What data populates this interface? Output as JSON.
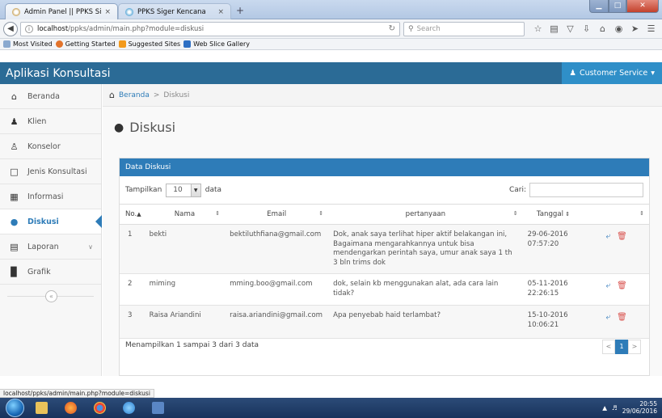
{
  "browser": {
    "tabs": [
      {
        "title": "Admin Panel || PPKS Siger ...",
        "close": "×"
      },
      {
        "title": "PPKS Siger Kencana",
        "close": "×"
      }
    ],
    "new_tab": "+",
    "url_host": "localhost",
    "url_path": "/ppks/admin/main.php?module=diskusi",
    "search_placeholder": "Search",
    "bookmarks": [
      "Most Visited",
      "Getting Started",
      "Suggested Sites",
      "Web Slice Gallery"
    ],
    "status_url": "localhost/ppks/admin/main.php?module=diskusi"
  },
  "app": {
    "title": "Aplikasi Konsultasi",
    "user_menu": "Customer Service"
  },
  "sidebar": {
    "items": [
      {
        "label": "Beranda",
        "icon": "home-icon"
      },
      {
        "label": "Klien",
        "icon": "users-icon"
      },
      {
        "label": "Konselor",
        "icon": "user-icon"
      },
      {
        "label": "Jenis Konsultasi",
        "icon": "folder-icon"
      },
      {
        "label": "Informasi",
        "icon": "grid-icon"
      },
      {
        "label": "Diskusi",
        "icon": "comments-icon"
      },
      {
        "label": "Laporan",
        "icon": "file-icon"
      },
      {
        "label": "Grafik",
        "icon": "bar-chart-icon"
      }
    ]
  },
  "breadcrumb": {
    "home": "Beranda",
    "current": "Diskusi"
  },
  "page": {
    "title": "Diskusi"
  },
  "panel": {
    "heading": "Data Diskusi",
    "show_label": "Tampilkan",
    "page_length": "10",
    "data_label": "data",
    "search_label": "Cari:",
    "columns": [
      "No.",
      "Nama",
      "Email",
      "pertanyaan",
      "Tanggal",
      ""
    ],
    "rows": [
      {
        "no": "1",
        "nama": "bekti",
        "email": "bektiluthfiana@gmail.com",
        "pertanyaan": "Dok, anak saya terlihat hiper aktif belakangan ini, Bagaimana mengarahkannya untuk bisa mendengarkan perintah saya, umur anak saya 1 th 3 bln trims dok",
        "tanggal_date": "29-06-2016",
        "tanggal_time": "07:57:20"
      },
      {
        "no": "2",
        "nama": "miming",
        "email": "mming.boo@gmail.com",
        "pertanyaan": "dok, selain kb menggunakan alat, ada cara lain tidak?",
        "tanggal_date": "05-11-2016",
        "tanggal_time": "22:26:15"
      },
      {
        "no": "3",
        "nama": "Raisa Ariandini",
        "email": "raisa.ariandini@gmail.com",
        "pertanyaan": "Apa penyebab haid terlambat?",
        "tanggal_date": "15-10-2016",
        "tanggal_time": "10:06:21"
      }
    ],
    "info": "Menampilkan 1 sampai 3 dari 3 data",
    "pager": {
      "prev": "<",
      "current": "1",
      "next": ">"
    }
  },
  "taskbar": {
    "time": "20:55",
    "date": "29/06/2016"
  },
  "colors": {
    "header": "#2b6b96",
    "accent": "#2e7cb8",
    "user_menu": "#2f8fc8",
    "delete": "#d9534f"
  }
}
